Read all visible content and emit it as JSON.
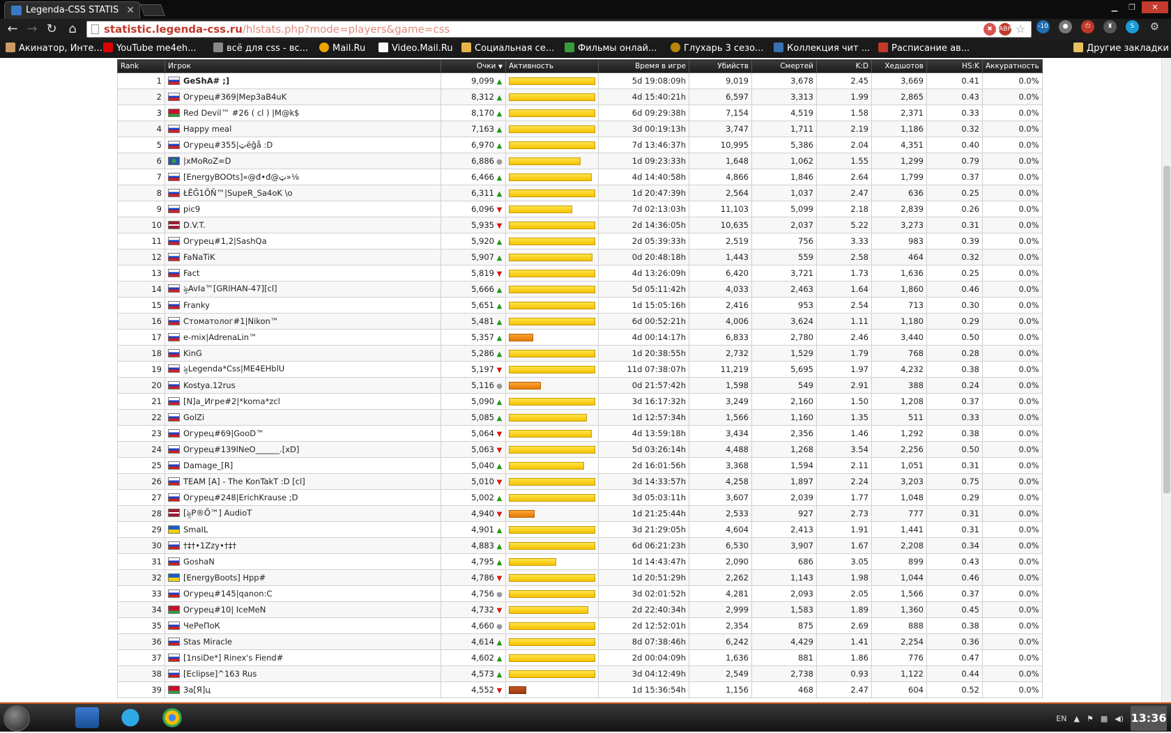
{
  "browser": {
    "tab_title": "Legenda-CSS STATIS",
    "url_host": "statistic.legenda-css.ru",
    "url_path": "/hlstats.php?mode=players&game=css",
    "bookmarks": [
      "Акинатор, Инте...",
      "YouTube me4eh...",
      "всё для css - вс...",
      "Mail.Ru",
      "Video.Mail.Ru",
      "Социальная се...",
      "Фильмы онлай...",
      "Глухарь 3 сезо...",
      "Коллекция чит ...",
      "Расписание ав..."
    ],
    "other_bookmarks": "Другие закладки"
  },
  "table": {
    "headers": {
      "rank": "Rank",
      "player": "Игрок",
      "points": "Очки",
      "activity": "Активность",
      "time": "Время в игре",
      "kills": "Убийств",
      "deaths": "Смертей",
      "kd": "K:D",
      "headshots": "Хедшотов",
      "hsk": "HS:K",
      "accuracy": "Аккуратность"
    },
    "rows": [
      {
        "rank": "1",
        "flag": "ru",
        "name": "GeShA# ;]",
        "bold": true,
        "points": "9,099",
        "trend": "up",
        "activity": 1.0,
        "time": "5d 19:08:09h",
        "kills": "9,019",
        "deaths": "3,678",
        "kd": "2.45",
        "hs": "3,669",
        "hsk": "0.41",
        "acc": "0.0%"
      },
      {
        "rank": "2",
        "flag": "ru",
        "name": "Огурец#369|Mep3aB4uK",
        "points": "8,312",
        "trend": "up",
        "activity": 1.0,
        "time": "4d 15:40:21h",
        "kills": "6,597",
        "deaths": "3,313",
        "kd": "1.99",
        "hs": "2,865",
        "hsk": "0.43",
        "acc": "0.0%"
      },
      {
        "rank": "3",
        "flag": "by",
        "name": "Red Devil™ #26 ( cl ) |M@k$",
        "points": "8,170",
        "trend": "up",
        "activity": 1.0,
        "time": "6d 09:29:38h",
        "kills": "7,154",
        "deaths": "4,519",
        "kd": "1.58",
        "hs": "2,371",
        "hsk": "0.33",
        "acc": "0.0%"
      },
      {
        "rank": "4",
        "flag": "ru",
        "name": "Happy meal",
        "points": "7,163",
        "trend": "up",
        "activity": 1.0,
        "time": "3d 00:19:13h",
        "kills": "3,747",
        "deaths": "1,711",
        "kd": "2.19",
        "hs": "1,186",
        "hsk": "0.32",
        "acc": "0.0%"
      },
      {
        "rank": "5",
        "flag": "ru",
        "name": "Огурец#355|ټëĝå :D",
        "points": "6,970",
        "trend": "up",
        "activity": 1.0,
        "time": "7d 13:46:37h",
        "kills": "10,995",
        "deaths": "5,386",
        "kd": "2.04",
        "hs": "4,351",
        "hsk": "0.40",
        "acc": "0.0%"
      },
      {
        "rank": "6",
        "flag": "un",
        "name": "|xMoRoZ=D",
        "points": "6,886",
        "trend": "same",
        "activity": 0.83,
        "time": "1d 09:23:33h",
        "kills": "1,648",
        "deaths": "1,062",
        "kd": "1.55",
        "hs": "1,299",
        "hsk": "0.79",
        "acc": "0.0%"
      },
      {
        "rank": "7",
        "flag": "ru",
        "name": "[EnergyBOOts]«@đ•đ@ټ»⅛",
        "points": "6,466",
        "trend": "up",
        "activity": 0.96,
        "time": "4d 14:40:58h",
        "kills": "4,866",
        "deaths": "1,846",
        "kd": "2.64",
        "hs": "1,799",
        "hsk": "0.37",
        "acc": "0.0%"
      },
      {
        "rank": "8",
        "flag": "ru",
        "name": "ŁĔĜ1ŐŇ™|SupeR_Sa4oK \\o",
        "points": "6,311",
        "trend": "up",
        "activity": 1.0,
        "time": "1d 20:47:39h",
        "kills": "2,564",
        "deaths": "1,037",
        "kd": "2.47",
        "hs": "636",
        "hsk": "0.25",
        "acc": "0.0%"
      },
      {
        "rank": "9",
        "flag": "ru",
        "name": "pic9",
        "points": "6,096",
        "trend": "down",
        "activity": 0.73,
        "time": "7d 02:13:03h",
        "kills": "11,103",
        "deaths": "5,099",
        "kd": "2.18",
        "hs": "2,839",
        "hsk": "0.26",
        "acc": "0.0%"
      },
      {
        "rank": "10",
        "flag": "lv",
        "name": "D.V.T.",
        "points": "5,935",
        "trend": "down",
        "activity": 1.0,
        "time": "2d 14:36:05h",
        "kills": "10,635",
        "deaths": "2,037",
        "kd": "5.22",
        "hs": "3,273",
        "hsk": "0.31",
        "acc": "0.0%"
      },
      {
        "rank": "11",
        "flag": "ru",
        "name": "Огурец#1,2|SashQa",
        "points": "5,920",
        "trend": "up",
        "activity": 1.0,
        "time": "2d 05:39:33h",
        "kills": "2,519",
        "deaths": "756",
        "kd": "3.33",
        "hs": "983",
        "hsk": "0.39",
        "acc": "0.0%"
      },
      {
        "rank": "12",
        "flag": "ru",
        "name": "FaNaTiK",
        "points": "5,907",
        "trend": "up",
        "activity": 0.97,
        "time": "0d 20:48:18h",
        "kills": "1,443",
        "deaths": "559",
        "kd": "2.58",
        "hs": "464",
        "hsk": "0.32",
        "acc": "0.0%"
      },
      {
        "rank": "13",
        "flag": "ru",
        "name": "Fact",
        "points": "5,819",
        "trend": "down",
        "activity": 1.0,
        "time": "4d 13:26:09h",
        "kills": "6,420",
        "deaths": "3,721",
        "kd": "1.73",
        "hs": "1,636",
        "hsk": "0.25",
        "acc": "0.0%"
      },
      {
        "rank": "14",
        "flag": "ru",
        "name": "ৡAvIa™[GRIHAN-47][cl]",
        "points": "5,666",
        "trend": "up",
        "activity": 1.0,
        "time": "5d 05:11:42h",
        "kills": "4,033",
        "deaths": "2,463",
        "kd": "1.64",
        "hs": "1,860",
        "hsk": "0.46",
        "acc": "0.0%"
      },
      {
        "rank": "15",
        "flag": "ru",
        "name": "Franky",
        "points": "5,651",
        "trend": "up",
        "activity": 1.0,
        "time": "1d 15:05:16h",
        "kills": "2,416",
        "deaths": "953",
        "kd": "2.54",
        "hs": "713",
        "hsk": "0.30",
        "acc": "0.0%"
      },
      {
        "rank": "16",
        "flag": "ru",
        "name": "Стоматолог#1|Nikon™",
        "points": "5,481",
        "trend": "up",
        "activity": 1.0,
        "time": "6d 00:52:21h",
        "kills": "4,006",
        "deaths": "3,624",
        "kd": "1.11",
        "hs": "1,180",
        "hsk": "0.29",
        "acc": "0.0%"
      },
      {
        "rank": "17",
        "flag": "ru",
        "name": "e-mix|AdrenaLin™",
        "points": "5,357",
        "trend": "up",
        "activity": 0.28,
        "bar": "orange",
        "time": "4d 00:14:17h",
        "kills": "6,833",
        "deaths": "2,780",
        "kd": "2.46",
        "hs": "3,440",
        "hsk": "0.50",
        "acc": "0.0%"
      },
      {
        "rank": "18",
        "flag": "ru",
        "name": "KinG",
        "points": "5,286",
        "trend": "up",
        "activity": 1.0,
        "time": "1d 20:38:55h",
        "kills": "2,732",
        "deaths": "1,529",
        "kd": "1.79",
        "hs": "768",
        "hsk": "0.28",
        "acc": "0.0%"
      },
      {
        "rank": "19",
        "flag": "ru",
        "name": "ৡLegenda*Css|ME4EHblU",
        "points": "5,197",
        "trend": "down",
        "activity": 1.0,
        "time": "11d 07:38:07h",
        "kills": "11,219",
        "deaths": "5,695",
        "kd": "1.97",
        "hs": "4,232",
        "hsk": "0.38",
        "acc": "0.0%"
      },
      {
        "rank": "20",
        "flag": "ru",
        "name": "Kostya.12rus",
        "points": "5,116",
        "trend": "same",
        "activity": 0.37,
        "bar": "orange",
        "time": "0d 21:57:42h",
        "kills": "1,598",
        "deaths": "549",
        "kd": "2.91",
        "hs": "388",
        "hsk": "0.24",
        "acc": "0.0%"
      },
      {
        "rank": "21",
        "flag": "ru",
        "name": "[N]a_Игре#2|*koma*zcl",
        "points": "5,090",
        "trend": "up",
        "activity": 1.0,
        "time": "3d 16:17:32h",
        "kills": "3,249",
        "deaths": "2,160",
        "kd": "1.50",
        "hs": "1,208",
        "hsk": "0.37",
        "acc": "0.0%"
      },
      {
        "rank": "22",
        "flag": "ru",
        "name": "GolZi",
        "points": "5,085",
        "trend": "up",
        "activity": 0.9,
        "time": "1d 12:57:34h",
        "kills": "1,566",
        "deaths": "1,160",
        "kd": "1.35",
        "hs": "511",
        "hsk": "0.33",
        "acc": "0.0%"
      },
      {
        "rank": "23",
        "flag": "ru",
        "name": "Огурец#69|GooD™",
        "points": "5,064",
        "trend": "down",
        "activity": 0.96,
        "time": "4d 13:59:18h",
        "kills": "3,434",
        "deaths": "2,356",
        "kd": "1.46",
        "hs": "1,292",
        "hsk": "0.38",
        "acc": "0.0%"
      },
      {
        "rank": "24",
        "flag": "ru",
        "name": "Огурец#139lNeO______.[xD]",
        "points": "5,063",
        "trend": "down",
        "activity": 1.0,
        "time": "5d 03:26:14h",
        "kills": "4,488",
        "deaths": "1,268",
        "kd": "3.54",
        "hs": "2,256",
        "hsk": "0.50",
        "acc": "0.0%"
      },
      {
        "rank": "25",
        "flag": "ru",
        "name": "Damage_[R]",
        "points": "5,040",
        "trend": "up",
        "activity": 0.87,
        "time": "2d 16:01:56h",
        "kills": "3,368",
        "deaths": "1,594",
        "kd": "2.11",
        "hs": "1,051",
        "hsk": "0.31",
        "acc": "0.0%"
      },
      {
        "rank": "26",
        "flag": "ru",
        "name": "TEAM [A] - The KonTakT :D [cl]",
        "points": "5,010",
        "trend": "down",
        "activity": 1.0,
        "time": "3d 14:33:57h",
        "kills": "4,258",
        "deaths": "1,897",
        "kd": "2.24",
        "hs": "3,203",
        "hsk": "0.75",
        "acc": "0.0%"
      },
      {
        "rank": "27",
        "flag": "ru",
        "name": "Огурец#248|ErichKrause ;D",
        "points": "5,002",
        "trend": "up",
        "activity": 1.0,
        "time": "3d 05:03:11h",
        "kills": "3,607",
        "deaths": "2,039",
        "kd": "1.77",
        "hs": "1,048",
        "hsk": "0.29",
        "acc": "0.0%"
      },
      {
        "rank": "28",
        "flag": "lv",
        "name": "[ৡP®Ő™] AudioT",
        "points": "4,940",
        "trend": "down",
        "activity": 0.3,
        "bar": "orange",
        "time": "1d 21:25:44h",
        "kills": "2,533",
        "deaths": "927",
        "kd": "2.73",
        "hs": "777",
        "hsk": "0.31",
        "acc": "0.0%"
      },
      {
        "rank": "29",
        "flag": "ua",
        "name": "SmaIL",
        "points": "4,901",
        "trend": "up",
        "activity": 1.0,
        "time": "3d 21:29:05h",
        "kills": "4,604",
        "deaths": "2,413",
        "kd": "1.91",
        "hs": "1,441",
        "hsk": "0.31",
        "acc": "0.0%"
      },
      {
        "rank": "30",
        "flag": "ru",
        "name": "†‡†•1Zzy•†‡†",
        "points": "4,883",
        "trend": "up",
        "activity": 1.0,
        "time": "6d 06:21:23h",
        "kills": "6,530",
        "deaths": "3,907",
        "kd": "1.67",
        "hs": "2,208",
        "hsk": "0.34",
        "acc": "0.0%"
      },
      {
        "rank": "31",
        "flag": "ru",
        "name": "GoshaN",
        "points": "4,795",
        "trend": "up",
        "activity": 0.55,
        "time": "1d 14:43:47h",
        "kills": "2,090",
        "deaths": "686",
        "kd": "3.05",
        "hs": "899",
        "hsk": "0.43",
        "acc": "0.0%"
      },
      {
        "rank": "32",
        "flag": "ua",
        "name": "[EnergyBoots] Hpp#",
        "points": "4,786",
        "trend": "down",
        "activity": 1.0,
        "time": "1d 20:51:29h",
        "kills": "2,262",
        "deaths": "1,143",
        "kd": "1.98",
        "hs": "1,044",
        "hsk": "0.46",
        "acc": "0.0%"
      },
      {
        "rank": "33",
        "flag": "ru",
        "name": "Огурец#145|qanon:C",
        "points": "4,756",
        "trend": "same",
        "activity": 1.0,
        "time": "3d 02:01:52h",
        "kills": "4,281",
        "deaths": "2,093",
        "kd": "2.05",
        "hs": "1,566",
        "hsk": "0.37",
        "acc": "0.0%"
      },
      {
        "rank": "34",
        "flag": "by",
        "name": "Огурец#10| IceMeN",
        "points": "4,732",
        "trend": "down",
        "activity": 0.92,
        "time": "2d 22:40:34h",
        "kills": "2,999",
        "deaths": "1,583",
        "kd": "1.89",
        "hs": "1,360",
        "hsk": "0.45",
        "acc": "0.0%"
      },
      {
        "rank": "35",
        "flag": "ru",
        "name": "ЧеРеПоК",
        "points": "4,660",
        "trend": "same",
        "activity": 1.0,
        "time": "2d 12:52:01h",
        "kills": "2,354",
        "deaths": "875",
        "kd": "2.69",
        "hs": "888",
        "hsk": "0.38",
        "acc": "0.0%"
      },
      {
        "rank": "36",
        "flag": "ru",
        "name": "Stas Miracle",
        "points": "4,614",
        "trend": "up",
        "activity": 1.0,
        "time": "8d 07:38:46h",
        "kills": "6,242",
        "deaths": "4,429",
        "kd": "1.41",
        "hs": "2,254",
        "hsk": "0.36",
        "acc": "0.0%"
      },
      {
        "rank": "37",
        "flag": "ru",
        "name": "[1nsiDe*] Rinex's Fiend#",
        "points": "4,602",
        "trend": "up",
        "activity": 1.0,
        "time": "2d 00:04:09h",
        "kills": "1,636",
        "deaths": "881",
        "kd": "1.86",
        "hs": "776",
        "hsk": "0.47",
        "acc": "0.0%"
      },
      {
        "rank": "38",
        "flag": "ru",
        "name": "[Eclipse]^163 Rus",
        "points": "4,573",
        "trend": "up",
        "activity": 1.0,
        "time": "3d 04:12:49h",
        "kills": "2,549",
        "deaths": "2,738",
        "kd": "0.93",
        "hs": "1,122",
        "hsk": "0.44",
        "acc": "0.0%"
      },
      {
        "rank": "39",
        "flag": "by",
        "name": "За[Я]ц",
        "points": "4,552",
        "trend": "down",
        "activity": 0.2,
        "bar": "brown",
        "time": "1d 15:36:54h",
        "kills": "1,156",
        "deaths": "468",
        "kd": "2.47",
        "hs": "604",
        "hsk": "0.52",
        "acc": "0.0%"
      }
    ]
  },
  "taskbar": {
    "lang": "EN",
    "clock": "13:36"
  },
  "icons": {
    "trend_up": "▲",
    "trend_down": "▼",
    "trend_same": "●",
    "sort_desc": "▼"
  }
}
